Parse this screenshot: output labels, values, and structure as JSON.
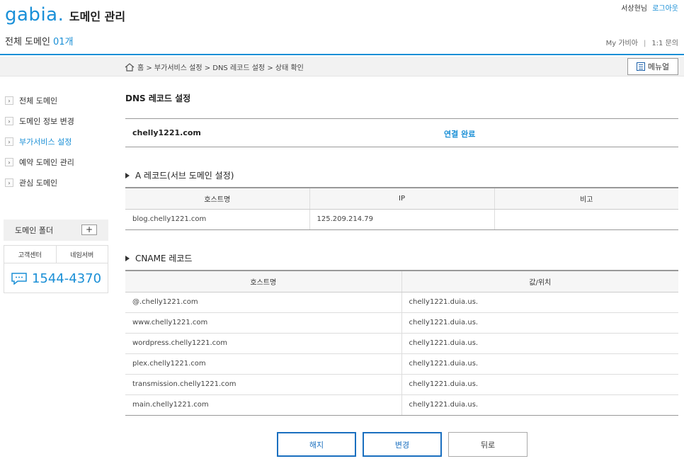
{
  "header": {
    "logo": "gabia",
    "logo_dot": ".",
    "app_title": "도메인 관리",
    "user_name": "서상현님",
    "logout": "로그아웃",
    "domain_count_label": "전체 도메인",
    "domain_count_value": "01개",
    "link_my": "My 가비아",
    "link_sep": "|",
    "link_inquiry": "1:1 문의"
  },
  "breadcrumb": {
    "text": "홈 > 부가서비스 설정 > DNS 레코드 설정 > 상태 확인",
    "menu_button": "메뉴얼"
  },
  "sidebar": {
    "items": [
      {
        "label": "전체 도메인",
        "active": false
      },
      {
        "label": "도메인 정보 변경",
        "active": false
      },
      {
        "label": "부가서비스 설정",
        "active": true
      },
      {
        "label": "예약 도메인 관리",
        "active": false
      },
      {
        "label": "관심 도메인",
        "active": false
      }
    ],
    "folder_label": "도메인 폴더",
    "folder_add": "+",
    "support_tab_1": "고객센터",
    "support_tab_2": "네임서버",
    "phone": "1544-4370"
  },
  "main": {
    "title": "DNS 레코드 설정",
    "domain": "chelly1221.com",
    "status": "연결 완료",
    "a_record": {
      "title": "A 레코드(서브 도메인 설정)",
      "headers": [
        "호스트명",
        "IP",
        "비고"
      ],
      "rows": [
        [
          "blog.chelly1221.com",
          "125.209.214.79",
          ""
        ]
      ]
    },
    "cname_record": {
      "title": "CNAME 레코드",
      "headers": [
        "호스트명",
        "값/위치"
      ],
      "rows": [
        [
          "@.chelly1221.com",
          "chelly1221.duia.us."
        ],
        [
          "www.chelly1221.com",
          "chelly1221.duia.us."
        ],
        [
          "wordpress.chelly1221.com",
          "chelly1221.duia.us."
        ],
        [
          "plex.chelly1221.com",
          "chelly1221.duia.us."
        ],
        [
          "transmission.chelly1221.com",
          "chelly1221.duia.us."
        ],
        [
          "main.chelly1221.com",
          "chelly1221.duia.us."
        ]
      ]
    },
    "buttons": {
      "cancel": "해지",
      "change": "변경",
      "back": "뒤로"
    }
  },
  "colors": {
    "accent": "#1a8fd6",
    "button_border": "#1a6fbf"
  }
}
